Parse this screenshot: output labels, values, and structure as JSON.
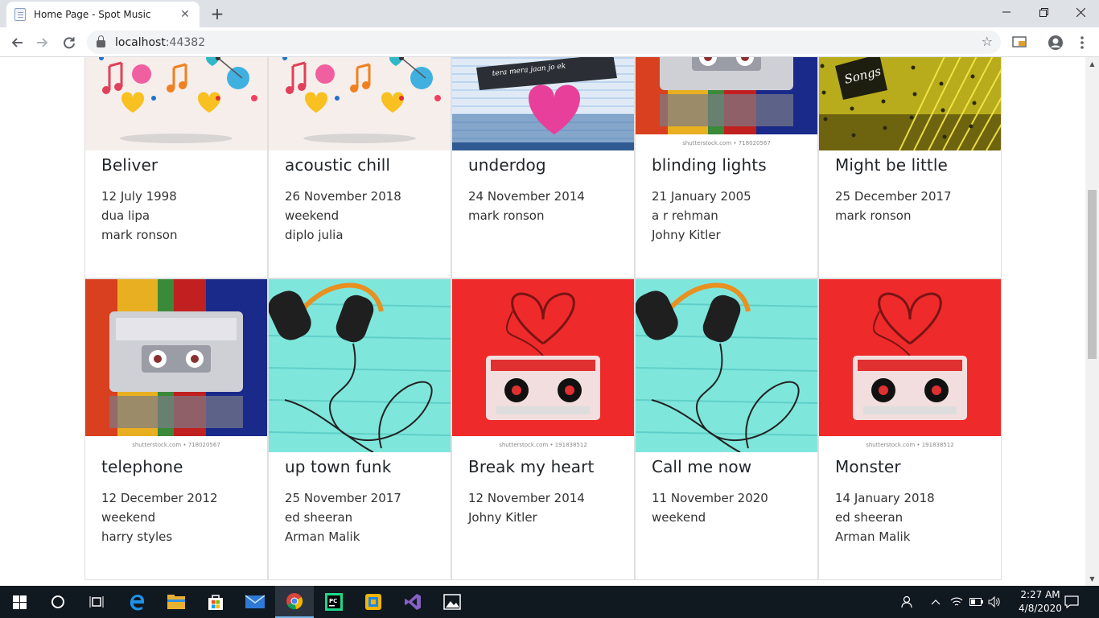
{
  "browser": {
    "tab_title": "Home Page - Spot Music",
    "tab_close": "✕",
    "new_tab": "+",
    "url_host": "localhost",
    "url_port": ":44382"
  },
  "cards": [
    {
      "title": "Beliver",
      "lines": [
        "12 July 1998",
        "dua lipa",
        "mark ronson"
      ],
      "art": "doodle-notes"
    },
    {
      "title": "acoustic chill",
      "lines": [
        "26 November 2018",
        "weekend",
        "diplo julia"
      ],
      "art": "doodle-notes"
    },
    {
      "title": "underdog",
      "lines": [
        "24 November 2014",
        "mark ronson"
      ],
      "art": "heart-notebook"
    },
    {
      "title": "blinding lights",
      "lines": [
        "21 January 2005",
        "a r rehman",
        "Johny Kitler"
      ],
      "art": "cassette-rainbow"
    },
    {
      "title": "Might be little",
      "lines": [
        "25 December 2017",
        "mark ronson"
      ],
      "art": "songs-yellow"
    },
    {
      "title": "telephone",
      "lines": [
        "12 December 2012",
        "weekend",
        "harry styles"
      ],
      "art": "cassette-rainbow"
    },
    {
      "title": "up town funk",
      "lines": [
        "25 November 2017",
        "ed sheeran",
        "Arman Malik"
      ],
      "art": "headphones-teal"
    },
    {
      "title": "Break my heart",
      "lines": [
        "12 November 2014",
        "Johny Kitler"
      ],
      "art": "cassette-red-hearts"
    },
    {
      "title": "Call me now",
      "lines": [
        "11 November 2020",
        "weekend"
      ],
      "art": "headphones-teal"
    },
    {
      "title": "Monster",
      "lines": [
        "14 January 2018",
        "ed sheeran",
        "Arman Malik"
      ],
      "art": "cassette-red-hearts"
    }
  ],
  "watermark": "shutterstock.com • 718020567",
  "watermark2": "shutterstock.com • 191838512",
  "taskbar": {
    "time": "2:27 AM",
    "date": "4/8/2020",
    "icons": [
      "windows-start-icon",
      "search-circle-icon",
      "task-view-icon",
      "edge-icon",
      "file-explorer-icon",
      "store-icon",
      "mail-icon",
      "chrome-icon",
      "pycharm-icon",
      "app-icon",
      "visual-studio-icon",
      "photos-icon"
    ]
  }
}
